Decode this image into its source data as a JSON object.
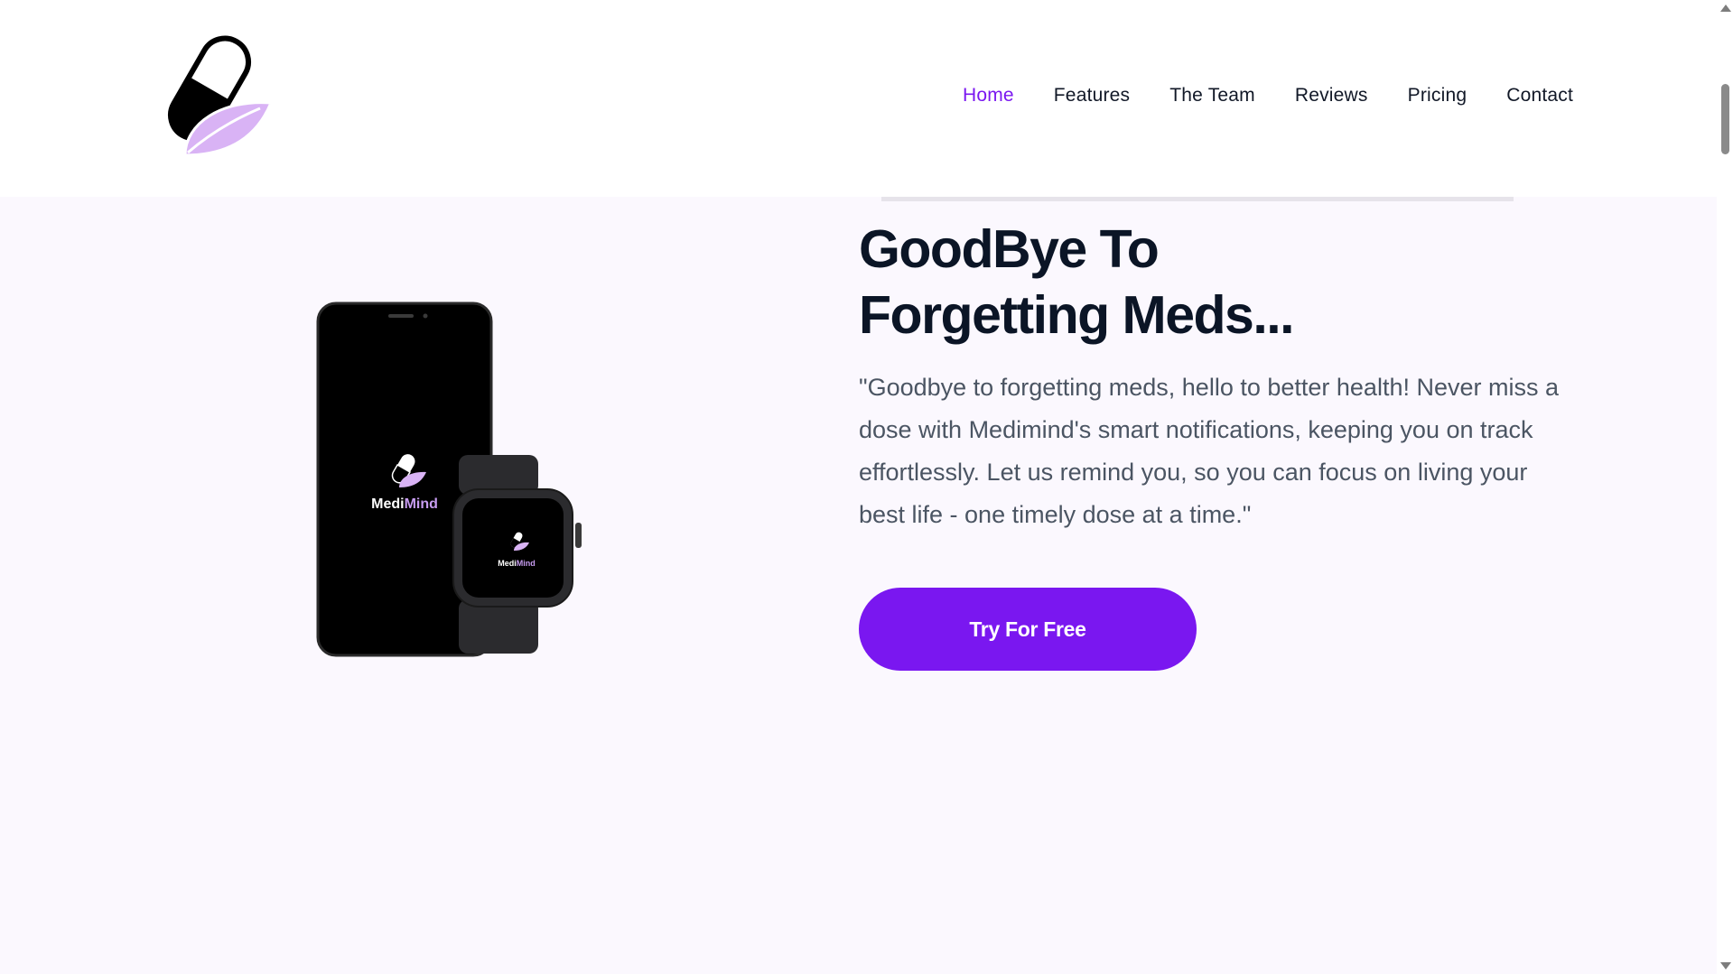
{
  "brand": {
    "logo_icon": "pill-leaf-logo",
    "accent_color": "#7a17f0",
    "leaf_color": "#d9b3f5"
  },
  "nav": {
    "items": [
      {
        "label": "Home",
        "active": true
      },
      {
        "label": "Features",
        "active": false
      },
      {
        "label": "The Team",
        "active": false
      },
      {
        "label": "Reviews",
        "active": false
      },
      {
        "label": "Pricing",
        "active": false
      },
      {
        "label": "Contact",
        "active": false
      }
    ]
  },
  "hero": {
    "title": "GoodBye To Forgetting Meds...",
    "description": "\"Goodbye to forgetting meds, hello to better health! Never miss a dose with Medimind's smart notifications, keeping you on track effortlessly. Let us remind you, so you can focus on living your best life - one timely dose at a time.\"",
    "cta_label": "Try For Free",
    "app_name_part1": "Medi",
    "app_name_part2": "Mind"
  }
}
